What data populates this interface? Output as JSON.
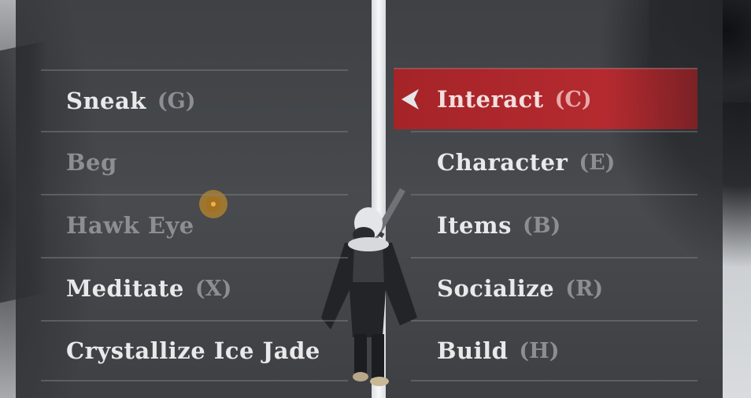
{
  "menu": {
    "left": [
      {
        "label": "Sneak",
        "key": "(G)",
        "enabled": true
      },
      {
        "label": "Beg",
        "key": "",
        "enabled": false
      },
      {
        "label": "Hawk Eye",
        "key": "",
        "enabled": false
      },
      {
        "label": "Meditate",
        "key": "(X)",
        "enabled": true
      },
      {
        "label": "Crystallize Ice Jade",
        "key": "",
        "enabled": true
      }
    ],
    "right": [
      {
        "label": "Interact",
        "key": "(C)",
        "enabled": true,
        "selected": true
      },
      {
        "label": "Character",
        "key": "(E)",
        "enabled": true
      },
      {
        "label": "Items",
        "key": "(B)",
        "enabled": true
      },
      {
        "label": "Socialize",
        "key": "(R)",
        "enabled": true
      },
      {
        "label": "Build",
        "key": "(H)",
        "enabled": true
      }
    ]
  },
  "icons": {
    "selection_indicator": "left-arrow-icon",
    "world_marker": "waypoint-marker-icon",
    "player": "player-character-icon"
  },
  "colors": {
    "selected_row": "#b62429",
    "label_enabled": "#e9e9ea",
    "label_disabled": "#8b8e93",
    "panel_bg": "#2c2e32"
  }
}
